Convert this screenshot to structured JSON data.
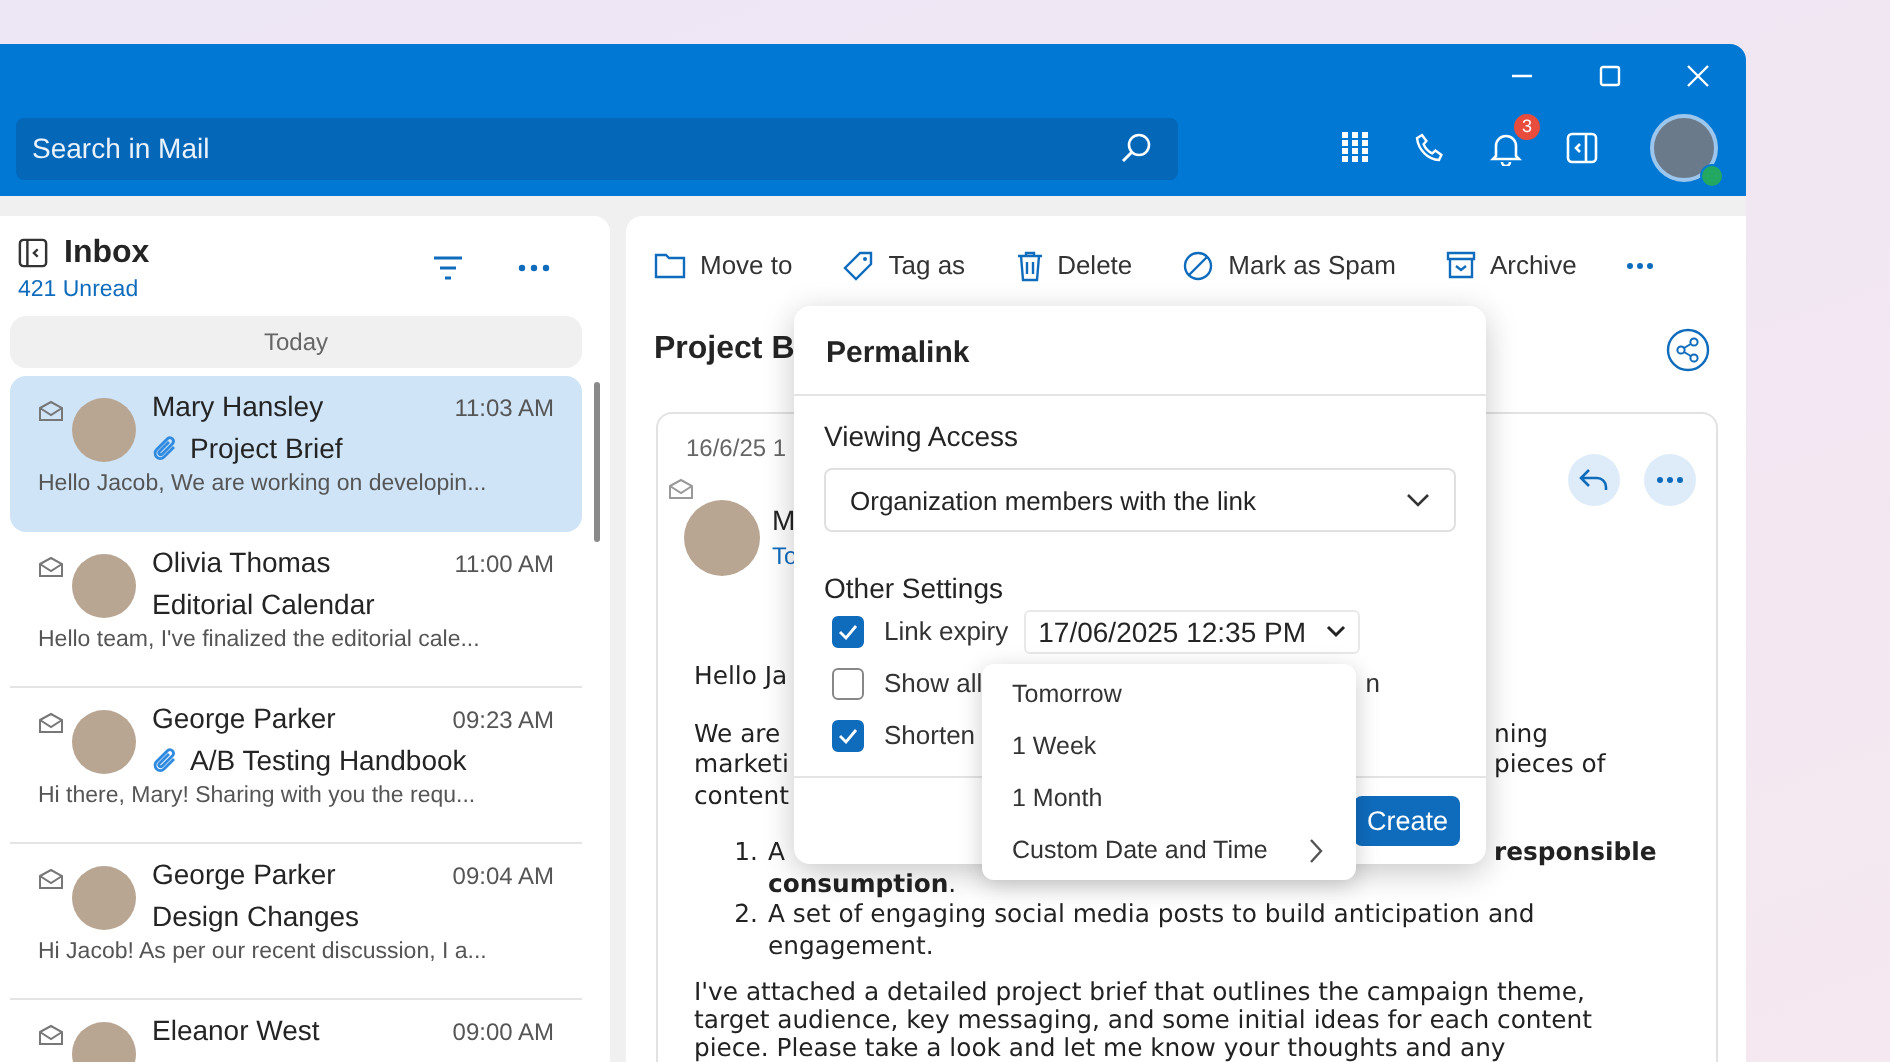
{
  "search": {
    "placeholder": "Search in Mail"
  },
  "notifications": {
    "badge": "3"
  },
  "profile": {
    "online": true
  },
  "inbox": {
    "title": "Inbox",
    "unread": "421 Unread",
    "group": "Today",
    "messages": [
      {
        "sender": "Mary Hansley",
        "time": "11:03 AM",
        "subject": "Project Brief",
        "preview": "Hello Jacob, We are working on developin...",
        "attachment": true,
        "selected": true
      },
      {
        "sender": "Olivia Thomas",
        "time": "11:00 AM",
        "subject": "Editorial Calendar",
        "preview": "Hello team, I've finalized the editorial cale...",
        "attachment": false,
        "selected": false
      },
      {
        "sender": "George Parker",
        "time": "09:23 AM",
        "subject": "A/B Testing Handbook",
        "preview": "Hi there, Mary! Sharing with you the requ...",
        "attachment": true,
        "selected": false
      },
      {
        "sender": "George Parker",
        "time": "09:04 AM",
        "subject": "Design Changes",
        "preview": "Hi Jacob! As per our recent discussion, I a...",
        "attachment": false,
        "selected": false
      },
      {
        "sender": "Eleanor West",
        "time": "09:00 AM",
        "selected": false
      }
    ]
  },
  "toolbar": [
    {
      "kind": "folder",
      "label": "Move to"
    },
    {
      "kind": "tag",
      "label": "Tag as"
    },
    {
      "kind": "trash",
      "label": "Delete"
    },
    {
      "kind": "block",
      "label": "Mark as Spam"
    },
    {
      "kind": "archive",
      "label": "Archive"
    }
  ],
  "reading_pane": {
    "subject": "Project B",
    "date": "16/6/25 1",
    "sender": "M",
    "to": "To",
    "body": [
      {
        "kind": "para",
        "lines": [
          {
            "left": "Hello Ja"
          }
        ]
      },
      {
        "kind": "para",
        "lines": [
          {
            "left": "We are",
            "right": "ning"
          },
          {
            "left": "marketi",
            "right": "pieces of"
          },
          {
            "left": "content"
          }
        ]
      },
      {
        "kind": "list",
        "items": [
          {
            "number": "1.",
            "lines": [
              {
                "left": "A",
                "right": "**responsible**"
              },
              {
                "left": "**consumption**."
              }
            ]
          },
          {
            "number": "2.",
            "lines": [
              {
                "left": "A set of engaging social media posts to build anticipation and"
              },
              {
                "left": "engagement."
              }
            ]
          }
        ]
      },
      {
        "kind": "para",
        "lines": [
          {
            "left": "I've attached a detailed project brief that outlines the campaign theme,"
          },
          {
            "left": "target audience, key messaging, and some initial ideas for each content"
          },
          {
            "left": "piece. Please take a look and let me know your thoughts and any"
          }
        ]
      }
    ]
  },
  "permalink": {
    "title": "Permalink",
    "access_label": "Viewing Access",
    "access_value": "Organization members with the link",
    "settings_label": "Other Settings",
    "settings": [
      {
        "label": "Link expiry",
        "checked": true,
        "value": "17/06/2025 12:35 PM"
      },
      {
        "label": "Show all",
        "checked": false,
        "tail": "n"
      },
      {
        "label": "Shorten",
        "checked": true
      }
    ],
    "create": "Create"
  },
  "expiry_menu": [
    {
      "label": "Tomorrow",
      "submenu": false
    },
    {
      "label": "1 Week",
      "submenu": false
    },
    {
      "label": "1 Month",
      "submenu": false
    },
    {
      "label": "Custom Date and Time",
      "submenu": true
    }
  ]
}
